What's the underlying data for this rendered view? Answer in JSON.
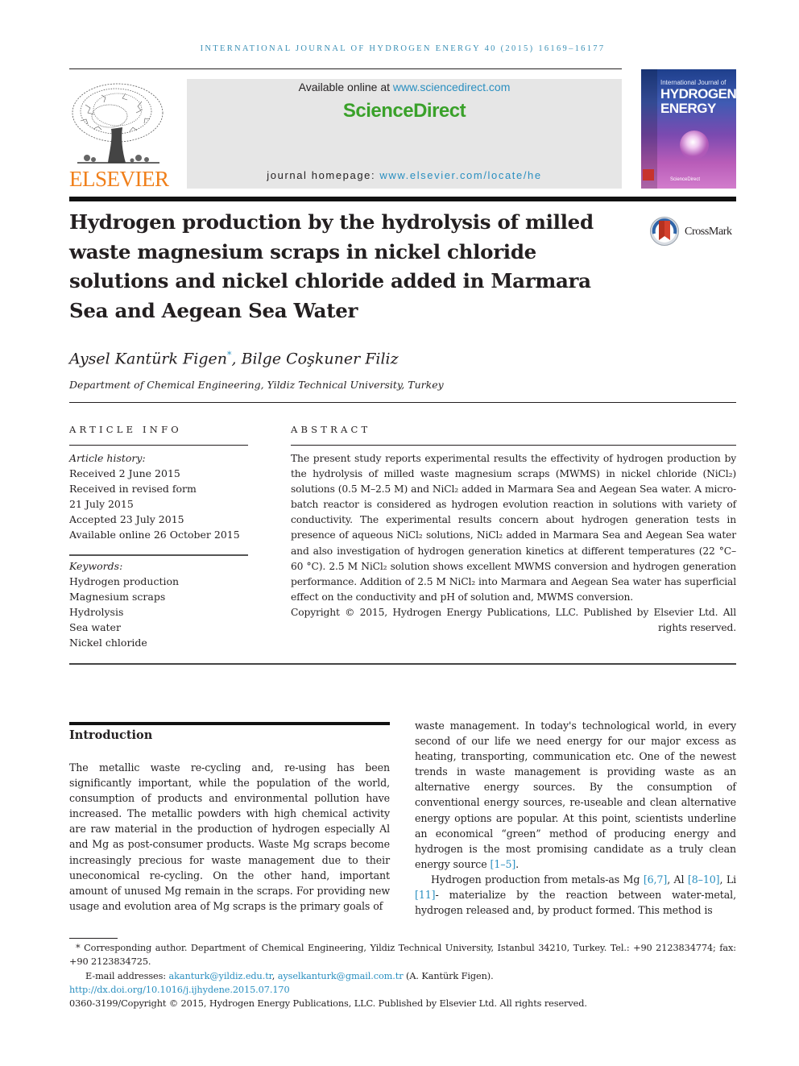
{
  "header": {
    "running_head": "INTERNATIONAL JOURNAL OF HYDROGEN ENERGY 40 (2015) 16169–16177",
    "publisher": "ELSEVIER",
    "available_online_prefix": "Available online at ",
    "available_online_link": "www.sciencedirect.com",
    "brand": "ScienceDirect",
    "homepage_prefix": "journal homepage: ",
    "homepage_link": "www.elsevier.com/locate/he",
    "cover": {
      "line1": "International Journal of",
      "line2": "HYDROGEN",
      "line3": "ENERGY",
      "sd": "ScienceDirect"
    },
    "colors": {
      "link": "#2a8fc0",
      "running_head": "#3a8fb5",
      "sciencedirect_green": "#3aa12a",
      "elsevier_orange": "#f07f1a",
      "banner_gray": "#e6e6e6"
    }
  },
  "article": {
    "title": "Hydrogen production by the hydrolysis of milled waste magnesium scraps in nickel chloride solutions and nickel chloride added in Marmara Sea and Aegean Sea Water",
    "crossmark_label": "CrossMark",
    "authors": [
      {
        "name": "Aysel Kantürk Figen",
        "mark": "*"
      },
      {
        "name": "Bilge Coşkuner Filiz",
        "mark": ""
      }
    ],
    "author_separator": ", ",
    "affiliation": "Department of Chemical Engineering, Yildiz Technical University, Turkey"
  },
  "article_info": {
    "heading": "ARTICLE INFO",
    "history_label": "Article history:",
    "history": [
      "Received 2 June 2015",
      "Received in revised form",
      "21 July 2015",
      "Accepted 23 July 2015",
      "Available online 26 October 2015"
    ],
    "keywords_label": "Keywords:",
    "keywords": [
      "Hydrogen production",
      "Magnesium scraps",
      "Hydrolysis",
      "Sea water",
      "Nickel chloride"
    ]
  },
  "abstract": {
    "heading": "ABSTRACT",
    "text": "The present study reports experimental results the effectivity of hydrogen production by the hydrolysis of milled waste magnesium scraps (MWMS) in nickel chloride (NiCl₂) solutions (0.5 M–2.5 M) and NiCl₂ added in Marmara Sea and Aegean Sea water. A micro-batch reactor is considered as hydrogen evolution reaction in solutions with variety of conductivity. The experimental results concern about hydrogen generation tests in presence of aqueous NiCl₂ solutions, NiCl₂ added in Marmara Sea and Aegean Sea water and also investigation of hydrogen generation kinetics at different temperatures (22 °C–60 °C). 2.5 M NiCl₂ solution shows excellent MWMS conversion and hydrogen generation performance. Addition of 2.5 M NiCl₂ into Marmara and Aegean Sea water has superficial effect on the conductivity and pH of solution and, MWMS conversion.",
    "copyright": "Copyright © 2015, Hydrogen Energy Publications, LLC. Published by Elsevier Ltd. All rights reserved."
  },
  "introduction": {
    "heading": "Introduction",
    "col1": "The metallic waste re-cycling and, re-using has been significantly important, while the population of the world, consumption of products and environmental pollution have increased. The metallic powders with high chemical activity are raw material in the production of hydrogen especially Al and Mg as post-consumer products. Waste Mg scraps become increasingly precious for waste management due to their uneconomical re-cycling. On the other hand, important amount of unused Mg remain in the scraps. For providing new usage and evolution area of Mg scraps is the primary goals of",
    "col2_p1": "waste management. In today's technological world, in every second of our life we need energy for our major excess as heating, transporting, communication etc. One of the newest trends in waste management is providing waste as an alternative energy sources. By the consumption of conventional energy sources, re-useable and clean alternative energy options are popular. At this point, scientists underline an economical “green” method of producing energy and hydrogen is the most promising candidate as a truly clean energy source ",
    "ref_1_5": "[1–5]",
    "col2_p1_end": ".",
    "col2_p2_a": "Hydrogen production from metals-as Mg ",
    "ref_6_7": "[6,7]",
    "col2_p2_b": ", Al ",
    "ref_8_10": "[8–10]",
    "col2_p2_c": ", Li ",
    "ref_11": "[11]",
    "col2_p2_d": "- materialize by the reaction between water-metal, hydrogen released and, by product formed. This method is"
  },
  "footnotes": {
    "corresponding": "* Corresponding author. Department of Chemical Engineering, Yildiz Technical University, Istanbul 34210, Turkey. Tel.: +90 2123834774; fax: +90 2123834725.",
    "email_prefix": "E-mail addresses: ",
    "email1": "akanturk@yildiz.edu.tr",
    "email_sep": ", ",
    "email2": "ayselkanturk@gmail.com.tr",
    "email_suffix": " (A. Kantürk Figen).",
    "doi": "http://dx.doi.org/10.1016/j.ijhydene.2015.07.170",
    "issn_copyright": "0360-3199/Copyright © 2015, Hydrogen Energy Publications, LLC. Published by Elsevier Ltd. All rights reserved."
  }
}
